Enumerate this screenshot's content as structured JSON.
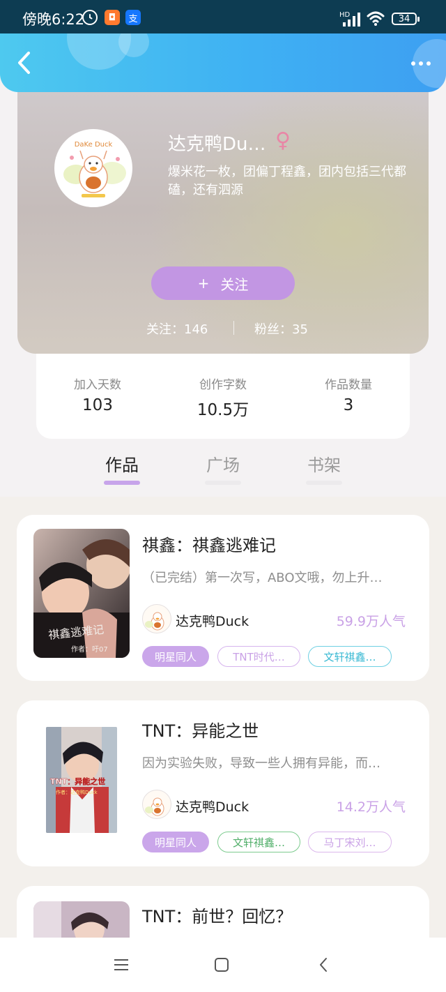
{
  "status_bar": {
    "time": "傍晚6:22",
    "icons": [
      "alarm-icon",
      "app-icon",
      "alipay-icon",
      "hd-icon",
      "signal-icon",
      "wifi-icon",
      "battery-icon"
    ],
    "hd_label": "HD",
    "battery_level": "34"
  },
  "header": {
    "back_icon": "chevron-left-icon",
    "more_icon": "more-dots-icon",
    "background_colors": [
      "#4ec9ef",
      "#3d9ff2"
    ]
  },
  "profile": {
    "nickname": "达克鸭Du…",
    "gender_icon": "female-symbol",
    "gender_glyph": "♀",
    "bio": "爆米花一枚，团偏丁程鑫，团内包括三代都磕，还有泗源",
    "follow_button": {
      "icon": "+",
      "label": "关注"
    },
    "following_label": "关注：146",
    "fans_label": "粉丝：35",
    "avatar_text": "DaKe Duck"
  },
  "stats": [
    {
      "label": "加入天数",
      "value": "103"
    },
    {
      "label": "创作字数",
      "value": "10.5万"
    },
    {
      "label": "作品数量",
      "value": "3"
    }
  ],
  "tabs": [
    {
      "label": "作品",
      "active": true
    },
    {
      "label": "广场",
      "active": false
    },
    {
      "label": "书架",
      "active": false
    }
  ],
  "works": [
    {
      "title": "祺鑫：祺鑫逃难记",
      "description": "（已完结）第一次写，ABO文哦，勿上升…",
      "author": "达克鸭Duck",
      "popularity": "59.9万人气",
      "cover_text": "祺鑫逃难记",
      "cover_subtext": "作者：吁07",
      "tags": [
        {
          "label": "明星同人",
          "style": "filled"
        },
        {
          "label": "TNT时代…",
          "style": "outline-purple"
        },
        {
          "label": "文轩祺鑫…",
          "style": "outline-teal"
        }
      ]
    },
    {
      "title": "TNT：异能之世",
      "description": "因为实验失败，导致一些人拥有异能，而…",
      "author": "达克鸭Duck",
      "popularity": "14.2万人气",
      "cover_text": "TNT：异能之世",
      "cover_subtext": "作者：达克鸭Duck",
      "tags": [
        {
          "label": "明星同人",
          "style": "filled"
        },
        {
          "label": "文轩祺鑫…",
          "style": "outline-green"
        },
        {
          "label": "马丁宋刘…",
          "style": "outline-pink"
        }
      ]
    },
    {
      "title": "TNT：前世？回忆？"
    }
  ],
  "nav_bar": {
    "icons": [
      "menu-icon",
      "home-square-icon",
      "back-triangle-icon"
    ]
  },
  "colors": {
    "accent_purple": "#c296e3",
    "tab_active_underline": "#c7a4ea",
    "popularity": "#c9a1e6"
  }
}
